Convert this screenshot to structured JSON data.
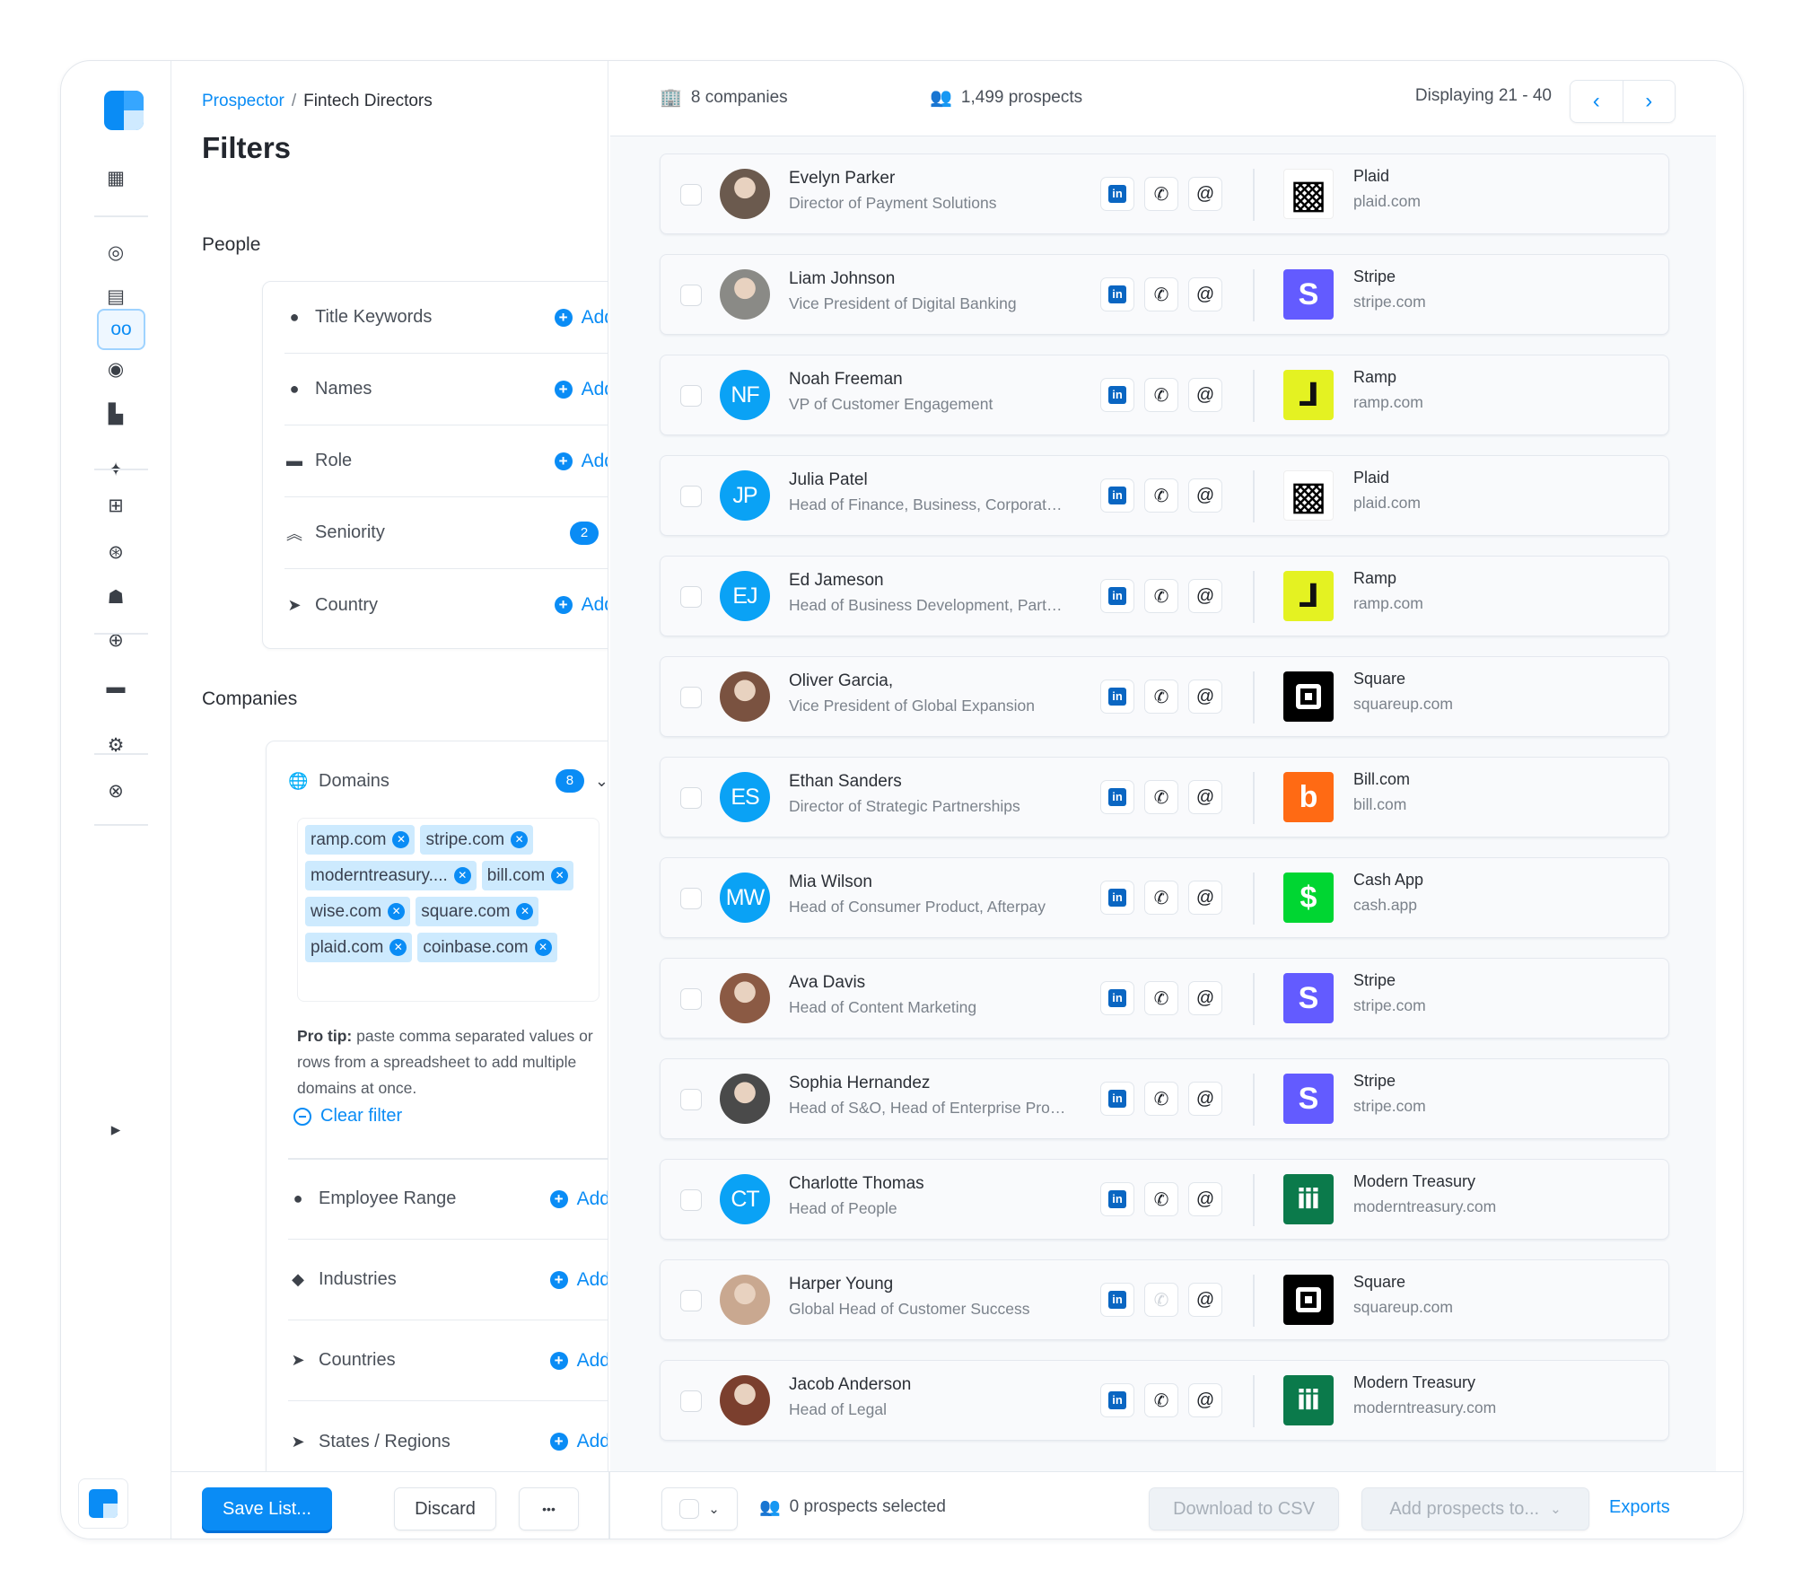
{
  "accent": "#0a8cf5",
  "rail": {
    "icons": [
      "dashboard-icon",
      "radar-icon",
      "inbox-icon",
      "binoculars-icon",
      "contacts-icon",
      "buildings-icon",
      "sparkle-scan-icon",
      "grid-icon",
      "search-people-icon",
      "team-icon",
      "globe-icon",
      "analytics-icon",
      "gear-icon",
      "support-icon",
      "collapse-icon"
    ],
    "active": "binoculars-icon"
  },
  "breadcrumb": {
    "root": "Prospector",
    "separator": "/",
    "current": "Fintech Directors"
  },
  "filters": {
    "title": "Filters",
    "people_label": "People",
    "people": [
      {
        "label": "Title Keywords",
        "icon": "person-icon",
        "action": "Add"
      },
      {
        "label": "Names",
        "icon": "person-icon",
        "action": "Add"
      },
      {
        "label": "Role",
        "icon": "briefcase-icon",
        "action": "Add"
      },
      {
        "label": "Seniority",
        "icon": "chevrons-up-icon",
        "badge": "2"
      },
      {
        "label": "Country",
        "icon": "location-arrow-icon",
        "action": "Add"
      }
    ],
    "companies_label": "Companies",
    "domains": {
      "label": "Domains",
      "badge": "8",
      "tags": [
        "ramp.com",
        "stripe.com",
        "moderntreasury....",
        "bill.com",
        "wise.com",
        "square.com",
        "plaid.com",
        "coinbase.com"
      ],
      "tip_bold": "Pro tip:",
      "tip": " paste comma separated values or rows from a spreadsheet to add multiple domains at once.",
      "clear": "Clear filter"
    },
    "companies": [
      {
        "label": "Employee Range",
        "icon": "people-icon",
        "action": "Add"
      },
      {
        "label": "Industries",
        "icon": "tags-icon",
        "action": "Add"
      },
      {
        "label": "Countries",
        "icon": "location-arrow-icon",
        "action": "Add"
      },
      {
        "label": "States / Regions",
        "icon": "location-arrow-icon",
        "action": "Add"
      }
    ]
  },
  "header": {
    "companies": "8 companies",
    "prospects": "1,499 prospects",
    "displaying": "Displaying 21 - 40"
  },
  "prospects": [
    {
      "name": "Evelyn Parker",
      "title": "Director of Payment Solutions",
      "avatar": "photo",
      "company": "Plaid",
      "domain": "plaid.com",
      "logo": "plaid"
    },
    {
      "name": "Liam Johnson",
      "title": "Vice President of Digital Banking",
      "avatar": "photo",
      "company": "Stripe",
      "domain": "stripe.com",
      "logo": "stripe"
    },
    {
      "name": "Noah Freeman",
      "title": "VP of Customer Engagement",
      "initials": "NF",
      "company": "Ramp",
      "domain": "ramp.com",
      "logo": "ramp"
    },
    {
      "name": "Julia Patel",
      "title": "Head of Finance, Business, Corporat…",
      "initials": "JP",
      "company": "Plaid",
      "domain": "plaid.com",
      "logo": "plaid"
    },
    {
      "name": "Ed Jameson",
      "title": "Head of Business Development, Part…",
      "initials": "EJ",
      "company": "Ramp",
      "domain": "ramp.com",
      "logo": "ramp"
    },
    {
      "name": "Oliver Garcia,",
      "title": "Vice President of Global Expansion",
      "avatar": "photo",
      "company": "Square",
      "domain": "squareup.com",
      "logo": "square"
    },
    {
      "name": "Ethan Sanders",
      "title": "Director of Strategic Partnerships",
      "initials": "ES",
      "company": "Bill.com",
      "domain": "bill.com",
      "logo": "bill"
    },
    {
      "name": "Mia Wilson",
      "title": "Head of Consumer Product, Afterpay",
      "initials": "MW",
      "company": "Cash App",
      "domain": "cash.app",
      "logo": "cashapp"
    },
    {
      "name": "Ava Davis",
      "title": "Head of Content Marketing",
      "avatar": "photo",
      "company": "Stripe",
      "domain": "stripe.com",
      "logo": "stripe"
    },
    {
      "name": "Sophia Hernandez",
      "title": "Head of S&O, Head of Enterprise Pro…",
      "avatar": "photo",
      "company": "Stripe",
      "domain": "stripe.com",
      "logo": "stripe"
    },
    {
      "name": "Charlotte Thomas",
      "title": "Head of People",
      "initials": "CT",
      "company": "Modern Treasury",
      "domain": "moderntreasury.com",
      "logo": "moderntreasury"
    },
    {
      "name": "Harper Young",
      "title": "Global Head of Customer Success",
      "avatar": "photo",
      "company": "Square",
      "domain": "squareup.com",
      "logo": "square",
      "phone_available": false
    },
    {
      "name": "Jacob Anderson",
      "title": "Head of Legal",
      "avatar": "photo",
      "company": "Modern Treasury",
      "domain": "moderntreasury.com",
      "logo": "moderntreasury"
    }
  ],
  "logo_colors": {
    "plaid": "#ffffff",
    "stripe": "#635bff",
    "ramp": "#e4f222",
    "square": "#000000",
    "bill": "#ff6a14",
    "cashapp": "#00d632",
    "moderntreasury": "#0b7a4b"
  },
  "footer": {
    "save": "Save List...",
    "discard": "Discard",
    "more": "•••",
    "selected": "0 prospects selected",
    "download": "Download to CSV",
    "add_to": "Add prospects to...",
    "exports": "Exports"
  }
}
